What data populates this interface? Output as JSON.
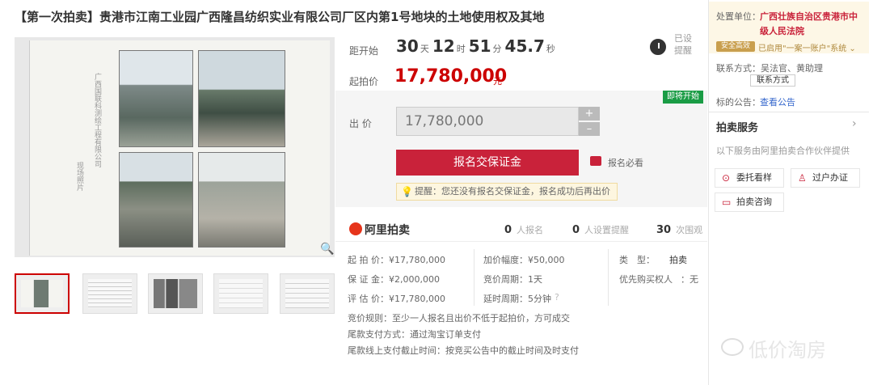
{
  "title": "【第一次拍卖】贵港市江南工业园广西隆昌纺织实业有限公司厂区内第1号地块的土地使用权及其地",
  "gallery": {
    "doc_text_1": "广西国联科测绘工程有限公司",
    "doc_text_2": "现场照片"
  },
  "countdown": {
    "label": "距开始",
    "days": "30",
    "days_unit": "天",
    "hours": "12",
    "hours_unit": "时",
    "minutes": "51",
    "minutes_unit": "分",
    "seconds": "45.7",
    "seconds_unit": "秒",
    "remind": "已设提醒"
  },
  "start_price": {
    "label": "起拍价",
    "value": "17,780,000",
    "unit": "元"
  },
  "bid": {
    "status_badge": "即将开始",
    "label": "出 价",
    "value": "17,780,000",
    "plus": "+",
    "minus": "–",
    "register_button": "报名交保证金",
    "must_read": "报名必看",
    "tip": "提醒：您还没有报名交保证金，报名成功后再出价"
  },
  "stats": {
    "brand": "阿里拍卖",
    "registered": {
      "count": "0",
      "label": "人报名"
    },
    "reminders": {
      "count": "0",
      "label": "人设置提醒"
    },
    "views": {
      "count": "30",
      "label": "次围观"
    }
  },
  "details": {
    "start_price": "起 拍 价：¥17,780,000",
    "deposit": "保 证 金：¥2,000,000",
    "assessed": "评 估 价：¥17,780,000",
    "increment": "加价幅度：¥50,000",
    "cycle": "竞价周期：1天",
    "extension": "延时周期：5分钟",
    "type_label": "类　型：",
    "type_value": "拍卖",
    "priority": "优先购买权人",
    "priority_value": "：无",
    "rule": "竞价规则：至少一人报名且出价不低于起拍价，方可成交",
    "payment": "尾款支付方式：通过淘宝订单支付",
    "deadline": "尾款线上支付截止时间：按竞买公告中的截止时间及时支付"
  },
  "sidebar": {
    "agency_label": "处置单位：",
    "agency_line1": "广西壮族自治区贵港市中",
    "agency_line2": "级人民法院",
    "verified": "安全高效",
    "account": "已启用\"一案一账户\"系统 ⌄",
    "contact": "联系方式：吴法官、黄助理",
    "contact_button": "联系方式",
    "announcement_label": "标的公告：",
    "announcement_link": "查看公告",
    "service_title": "拍卖服务",
    "service_desc": "以下服务由阿里拍卖合作伙伴提供",
    "service_1": "委托看样",
    "service_2": "过户办证",
    "service_3": "拍卖咨询",
    "watermark": "低价淘房"
  },
  "colors": {
    "accent": "#c9223a",
    "price": "#cc0000",
    "badge": "#1a9c45",
    "link": "#3366cc"
  }
}
